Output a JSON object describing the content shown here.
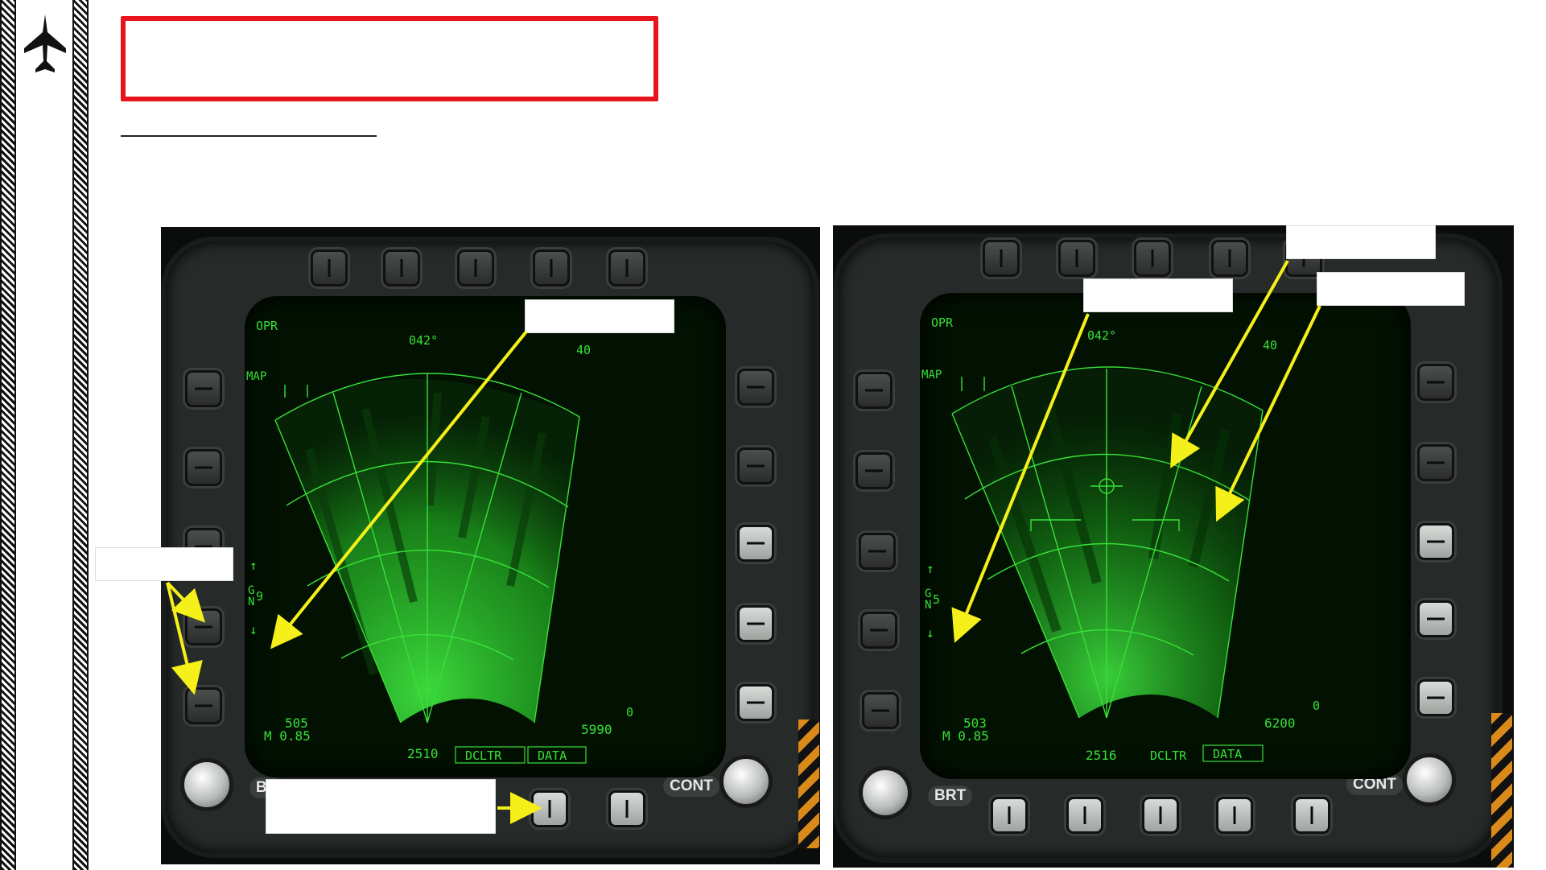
{
  "colors": {
    "accent_red": "#e8141c",
    "radar_green": "#38e038",
    "arrow_yellow": "#f5ef1a"
  },
  "header": {
    "icon": "fighter-jet-icon",
    "title": "",
    "subtitle": ""
  },
  "left_display": {
    "mode": "OPR",
    "map_label": "MAP",
    "heading": "042°",
    "range": "40",
    "gain_label": "G\nN",
    "gain_value": "9",
    "speed": "505",
    "mach": "M 0.85",
    "altitude": "5990",
    "elevation": "0",
    "bottom_value": "2510",
    "declutter_label": "DCLTR",
    "data_label": "DATA",
    "brt_label": "BR",
    "cont_label": "CONT",
    "callouts": [
      "",
      "",
      ""
    ]
  },
  "right_display": {
    "mode": "OPR",
    "map_label": "MAP",
    "heading": "042°",
    "range": "40",
    "gain_label": "G\nN",
    "gain_value": "5",
    "speed": "503",
    "mach": "M 0.85",
    "altitude": "6200",
    "elevation": "0",
    "bottom_value": "2516",
    "declutter_label": "DCLTR",
    "data_label": "DATA",
    "brt_label": "BRT",
    "cont_label": "CONT",
    "callouts": [
      "",
      "",
      ""
    ]
  }
}
